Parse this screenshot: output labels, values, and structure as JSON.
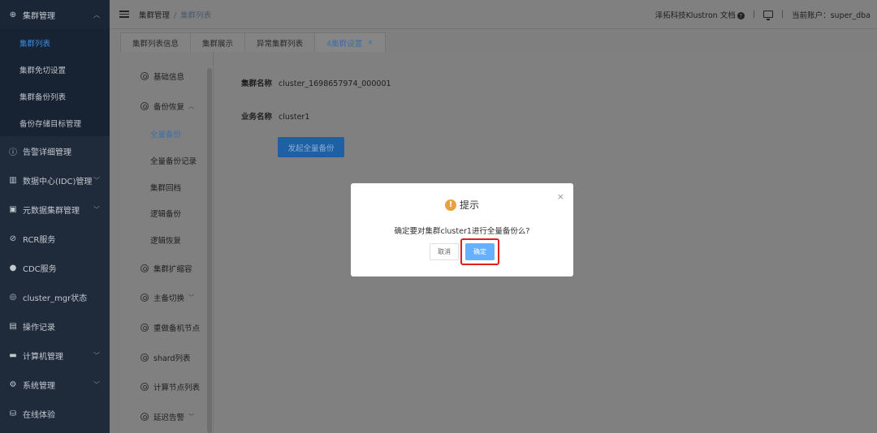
{
  "sidebar": {
    "groups": [
      {
        "label": "集群管理",
        "icon": "plus-circle-icon",
        "open": true,
        "children": [
          "集群列表",
          "集群免切设置",
          "集群备份列表",
          "备份存储目标管理"
        ]
      },
      {
        "label": "告警详细管理",
        "icon": "alert-circle-icon"
      },
      {
        "label": "数据中心(IDC)管理",
        "icon": "bar-chart-icon"
      },
      {
        "label": "元数据集群管理",
        "icon": "database-icon"
      },
      {
        "label": "RCR服务",
        "icon": "link-icon"
      },
      {
        "label": "CDC服务",
        "icon": "user-icon"
      },
      {
        "label": "cluster_mgr状态",
        "icon": "status-icon"
      },
      {
        "label": "操作记录",
        "icon": "document-icon"
      },
      {
        "label": "计算机管理",
        "icon": "monitor-icon"
      },
      {
        "label": "系统管理",
        "icon": "gear-icon"
      },
      {
        "label": "在线体验",
        "icon": "cylinder-icon"
      }
    ]
  },
  "topbar": {
    "breadcrumb_root": "集群管理",
    "breadcrumb_sep": "/",
    "breadcrumb_current": "集群列表",
    "docs_link": "泽拓科技Klustron 文档",
    "account_label": "当前账户：super_dba",
    "divider": "|"
  },
  "tabs": [
    {
      "label": "集群列表信息"
    },
    {
      "label": "集群展示"
    },
    {
      "label": "异常集群列表"
    },
    {
      "label": "4集群设置",
      "active": true,
      "close": "×"
    }
  ],
  "menu": {
    "basic_info": "基础信息",
    "backup_restore": "备份恢复",
    "full_backup": "全量备份",
    "full_backup_records": "全量备份记录",
    "cluster_rollback": "集群回档",
    "logical_backup": "逻辑备份",
    "logical_restore": "逻辑恢复",
    "cluster_scale": "集群扩缩容",
    "master_switch": "主备切换",
    "rebuild_standby": "重做备机节点",
    "shard_list": "shard列表",
    "compute_nodes": "计算节点列表",
    "delay_alert": "延迟告警"
  },
  "content": {
    "cluster_name_label": "集群名称",
    "cluster_name_value": "cluster_1698657974_000001",
    "business_name_label": "业务名称",
    "business_name_value": "cluster1",
    "start_full_backup": "发起全量备份"
  },
  "dialog": {
    "title": "提示",
    "message": "确定要对集群cluster1进行全量备份么?",
    "cancel": "取消",
    "confirm": "确定",
    "close": "×",
    "warn_glyph": "!"
  },
  "colors": {
    "sidebar_bg": "#1f2a3b",
    "active_link": "#3f8cdc",
    "primary": "#66b1ff",
    "warning": "#e6a23c",
    "highlight": "#e02020"
  }
}
